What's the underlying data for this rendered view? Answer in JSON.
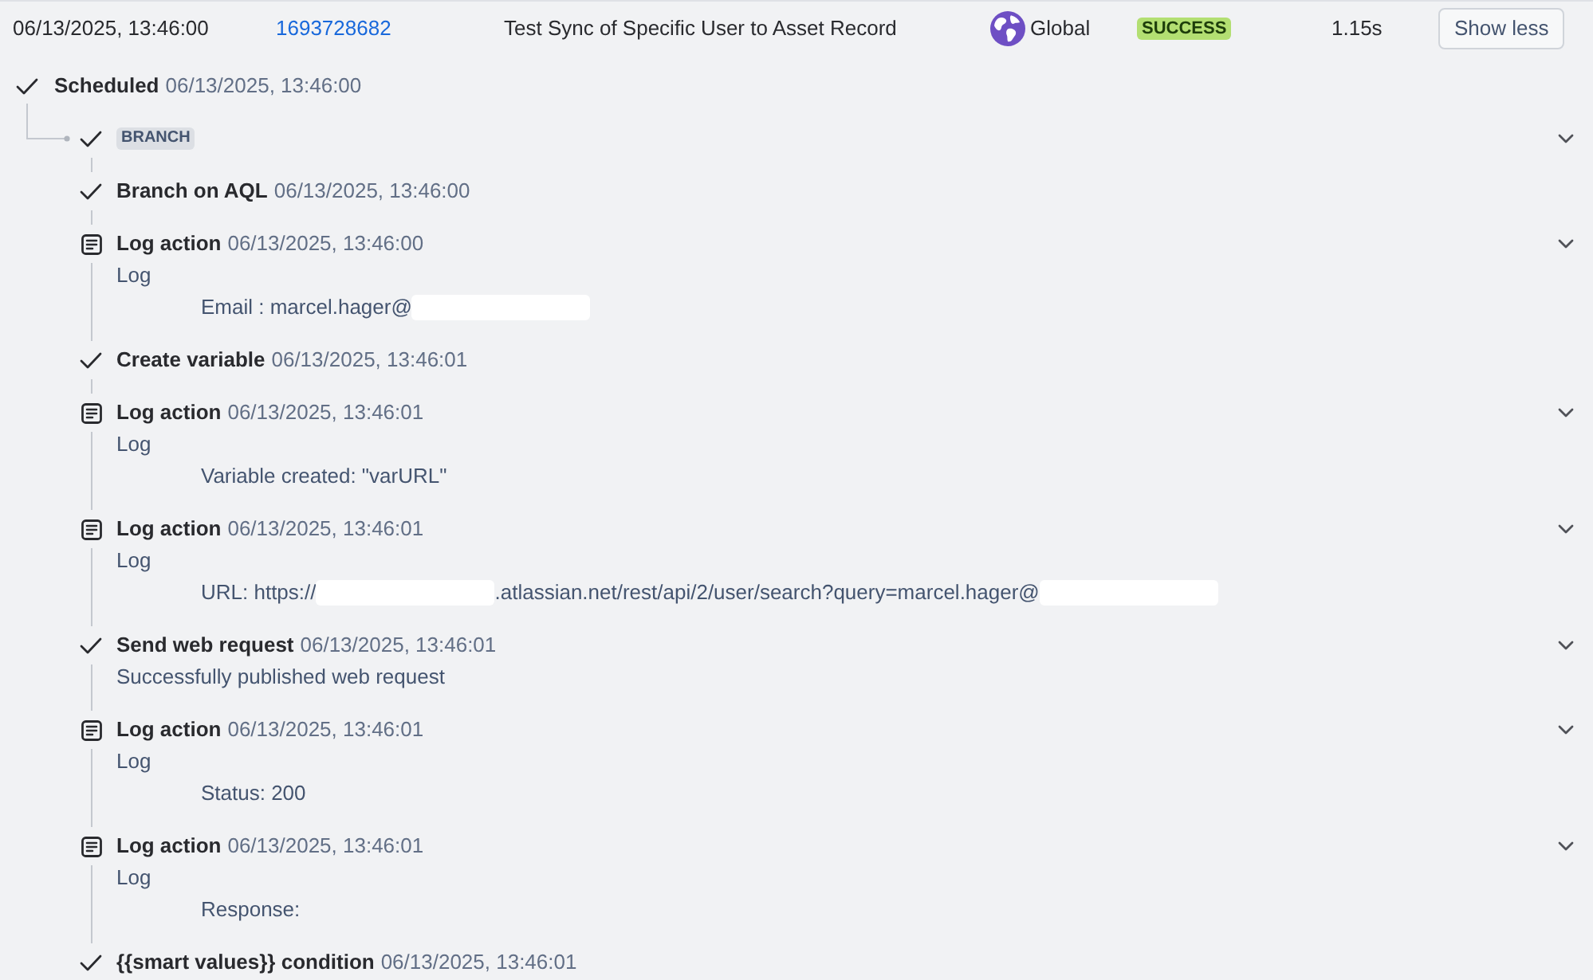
{
  "run_row": {
    "date": "06/13/2025, 13:46:00",
    "id": "1693728682",
    "rule": "Test Sync of Specific User to Asset Record",
    "scope": "Global",
    "status": {
      "kind": "success",
      "label": "SUCCESS"
    },
    "duration": "1.15s",
    "toggle_button": "Show less"
  },
  "trigger": {
    "kind": "check",
    "title": "Scheduled",
    "time": "06/13/2025, 13:46:00"
  },
  "branch": {
    "kind": "check",
    "badge": "BRANCH",
    "expandable": true
  },
  "steps": [
    {
      "kind": "check",
      "title": "Branch on AQL",
      "time": "06/13/2025, 13:46:00",
      "expandable": false
    },
    {
      "kind": "log",
      "title": "Log action",
      "time": "06/13/2025, 13:46:00",
      "expandable": true,
      "lines": [
        {
          "kind": "plain",
          "parts": [
            {
              "kind": "text",
              "text": "Log"
            }
          ]
        },
        {
          "kind": "indented",
          "parts": [
            {
              "kind": "text",
              "text": "Email : marcel.hager@"
            },
            {
              "kind": "redaction"
            }
          ]
        }
      ]
    },
    {
      "kind": "check",
      "title": "Create variable",
      "time": "06/13/2025, 13:46:01",
      "expandable": false
    },
    {
      "kind": "log",
      "title": "Log action",
      "time": "06/13/2025, 13:46:01",
      "expandable": true,
      "lines": [
        {
          "kind": "plain",
          "parts": [
            {
              "kind": "text",
              "text": "Log"
            }
          ]
        },
        {
          "kind": "indented",
          "parts": [
            {
              "kind": "text",
              "text": "Variable created: \"varURL\""
            }
          ]
        }
      ]
    },
    {
      "kind": "log",
      "title": "Log action",
      "time": "06/13/2025, 13:46:01",
      "expandable": true,
      "lines": [
        {
          "kind": "plain",
          "parts": [
            {
              "kind": "text",
              "text": "Log"
            }
          ]
        },
        {
          "kind": "indented",
          "parts": [
            {
              "kind": "text",
              "text": "URL: https://"
            },
            {
              "kind": "redaction"
            },
            {
              "kind": "text",
              "text": ".atlassian.net/rest/api/2/user/search?query=marcel.hager@"
            },
            {
              "kind": "redaction"
            }
          ]
        }
      ]
    },
    {
      "kind": "check",
      "title": "Send web request",
      "time": "06/13/2025, 13:46:01",
      "expandable": true,
      "lines": [
        {
          "kind": "plain",
          "parts": [
            {
              "kind": "text",
              "text": "Successfully published web request"
            }
          ]
        }
      ]
    },
    {
      "kind": "log",
      "title": "Log action",
      "time": "06/13/2025, 13:46:01",
      "expandable": true,
      "lines": [
        {
          "kind": "plain",
          "parts": [
            {
              "kind": "text",
              "text": "Log"
            }
          ]
        },
        {
          "kind": "indented",
          "parts": [
            {
              "kind": "text",
              "text": "Status: 200"
            }
          ]
        }
      ]
    },
    {
      "kind": "log",
      "title": "Log action",
      "time": "06/13/2025, 13:46:01",
      "expandable": true,
      "lines": [
        {
          "kind": "plain",
          "parts": [
            {
              "kind": "text",
              "text": "Log"
            }
          ]
        },
        {
          "kind": "indented",
          "parts": [
            {
              "kind": "text",
              "text": "Response:"
            }
          ]
        }
      ]
    },
    {
      "kind": "check",
      "title": "{{smart values}} condition",
      "time": "06/13/2025, 13:46:01",
      "expandable": false
    }
  ]
}
